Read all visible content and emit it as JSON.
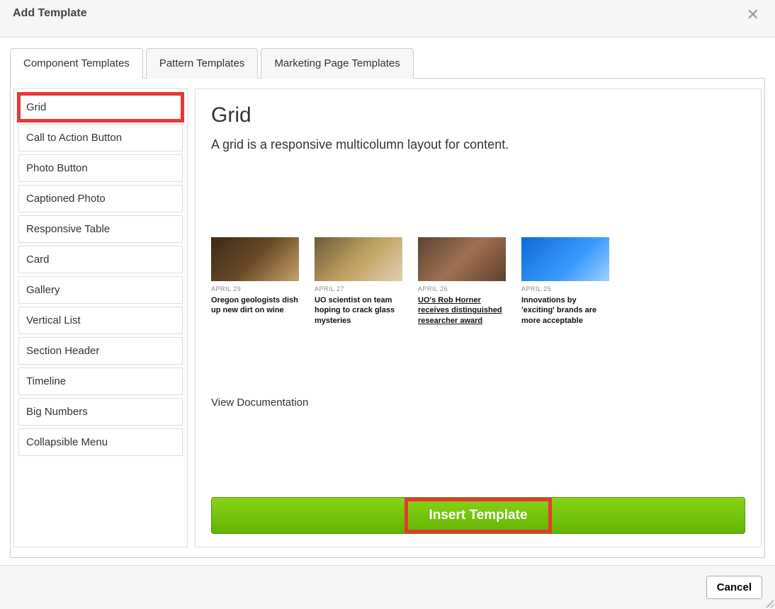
{
  "header": {
    "title": "Add Template"
  },
  "tabs": [
    {
      "label": "Component Templates"
    },
    {
      "label": "Pattern Templates"
    },
    {
      "label": "Marketing Page Templates"
    }
  ],
  "sidebar": {
    "items": [
      {
        "label": "Grid"
      },
      {
        "label": "Call to Action Button"
      },
      {
        "label": "Photo Button"
      },
      {
        "label": "Captioned Photo"
      },
      {
        "label": "Responsive Table"
      },
      {
        "label": "Card"
      },
      {
        "label": "Gallery"
      },
      {
        "label": "Vertical List"
      },
      {
        "label": "Section Header"
      },
      {
        "label": "Timeline"
      },
      {
        "label": "Big Numbers"
      },
      {
        "label": "Collapsible Menu"
      }
    ]
  },
  "preview": {
    "title": "Grid",
    "description": "A grid is a responsive multicolumn layout for content.",
    "view_doc_label": "View Documentation",
    "insert_label": "Insert Template",
    "cards": [
      {
        "date": "APRIL 29",
        "headline": "Oregon geologists dish up new dirt on wine"
      },
      {
        "date": "APRIL 27",
        "headline": "UO scientist on team hoping to crack glass mysteries"
      },
      {
        "date": "APRIL 26",
        "headline": "UO's Rob Horner receives distinguished researcher award"
      },
      {
        "date": "APRIL 25",
        "headline": "Innovations by 'exciting' brands are more acceptable"
      }
    ]
  },
  "footer": {
    "cancel_label": "Cancel"
  }
}
